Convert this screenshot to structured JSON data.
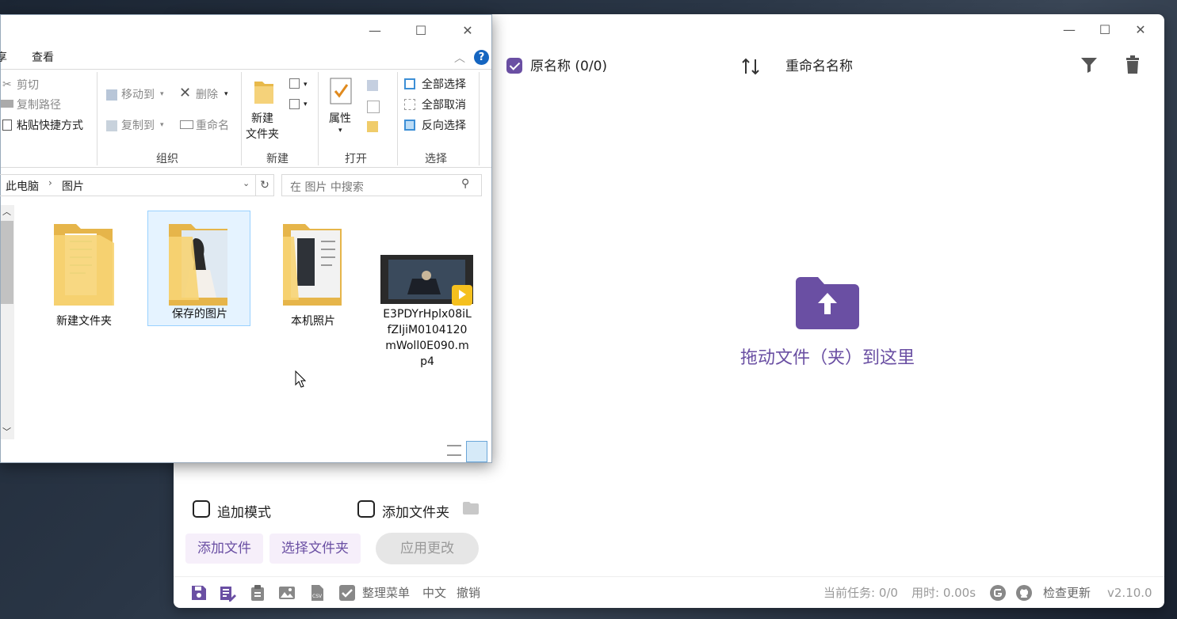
{
  "app": {
    "header": {
      "original_label": "原名称 (0/0)",
      "rename_label": "重命名名称"
    },
    "drop_zone_text": "拖动文件（夹）到这里",
    "options": {
      "append_mode": "追加模式",
      "add_folder": "添加文件夹"
    },
    "buttons": {
      "add_files": "添加文件",
      "select_folder": "选择文件夹",
      "apply_changes": "应用更改"
    },
    "footer": {
      "organize_menu": "整理菜单",
      "language": "中文",
      "undo": "撤销",
      "current_tasks": "当前任务: 0/0",
      "elapsed": "用时: 0.00s",
      "check_update": "检查更新",
      "version": "v2.10.0"
    },
    "accent_color": "#6a4fa3"
  },
  "explorer": {
    "ribbon_tabs": [
      "享",
      "查看"
    ],
    "clipboard": {
      "cut": "剪切",
      "copy_path": "复制路径",
      "paste_shortcut": "粘贴快捷方式"
    },
    "organize": {
      "move_to": "移动到",
      "delete": "删除",
      "copy_to": "复制到",
      "rename": "重命名",
      "group": "组织"
    },
    "new": {
      "new_folder_line1": "新建",
      "new_folder_line2": "文件夹",
      "group": "新建"
    },
    "open": {
      "properties": "属性",
      "group": "打开"
    },
    "select": {
      "select_all": "全部选择",
      "select_none": "全部取消",
      "invert": "反向选择",
      "group": "选择"
    },
    "breadcrumb": [
      "此电脑",
      "图片"
    ],
    "search_placeholder": "在 图片 中搜索",
    "items": [
      {
        "name": "新建文件夹"
      },
      {
        "name": "保存的图片"
      },
      {
        "name": "本机照片"
      },
      {
        "name_lines": [
          "E3PDYrHplx08iL",
          "fZIjiM0104120",
          "mWoll0E090.m",
          "p4"
        ]
      }
    ]
  }
}
